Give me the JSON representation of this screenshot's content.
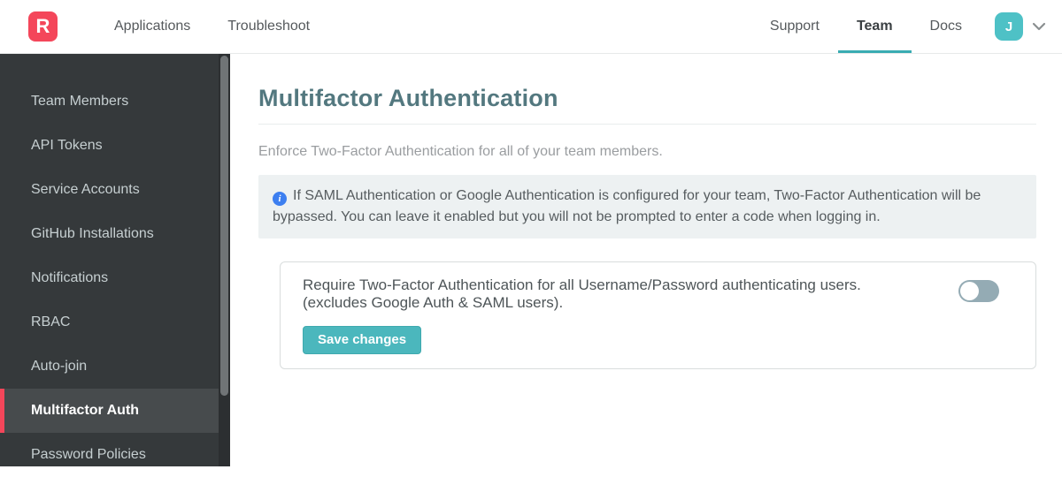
{
  "header": {
    "logo_letter": "R",
    "nav_left": [
      {
        "label": "Applications"
      },
      {
        "label": "Troubleshoot"
      }
    ],
    "nav_right": [
      {
        "label": "Support",
        "active": false
      },
      {
        "label": "Team",
        "active": true
      },
      {
        "label": "Docs",
        "active": false
      }
    ],
    "avatar_initial": "J",
    "account_menu_icon": "chevron-down-icon"
  },
  "sidebar": {
    "items": [
      {
        "label": "Team Members",
        "active": false
      },
      {
        "label": "API Tokens",
        "active": false
      },
      {
        "label": "Service Accounts",
        "active": false
      },
      {
        "label": "GitHub Installations",
        "active": false
      },
      {
        "label": "Notifications",
        "active": false
      },
      {
        "label": "RBAC",
        "active": false
      },
      {
        "label": "Auto-join",
        "active": false
      },
      {
        "label": "Multifactor Auth",
        "active": true
      },
      {
        "label": "Password Policies",
        "active": false
      }
    ]
  },
  "main": {
    "title": "Multifactor Authentication",
    "description": "Enforce Two-Factor Authentication for all of your team members.",
    "info_icon": "info-icon",
    "info_icon_glyph": "i",
    "info_note": "If SAML Authentication or Google Authentication is configured for your team, Two-Factor Authentication will be bypassed. You can leave it enabled but you will not be prompted to enter a code when logging in.",
    "setting": {
      "label_line1": "Require Two-Factor Authentication for all Username/Password authenticating users.",
      "label_line2": "(excludes Google Auth & SAML users).",
      "toggle_state": "off",
      "save_button_label": "Save changes"
    }
  },
  "colors": {
    "brand_red": "#f4465a",
    "accent_teal": "#4bb7bd",
    "avatar_teal": "#4ec1c6",
    "nav_active_underline": "#39acb2",
    "sidebar_bg": "#35393b",
    "sidebar_active_bg": "#474b4d",
    "heading_teal": "#53787f",
    "info_box_bg": "#edf1f2",
    "info_icon_blue": "#3d7ff0",
    "toggle_off_track": "#94abb4"
  }
}
